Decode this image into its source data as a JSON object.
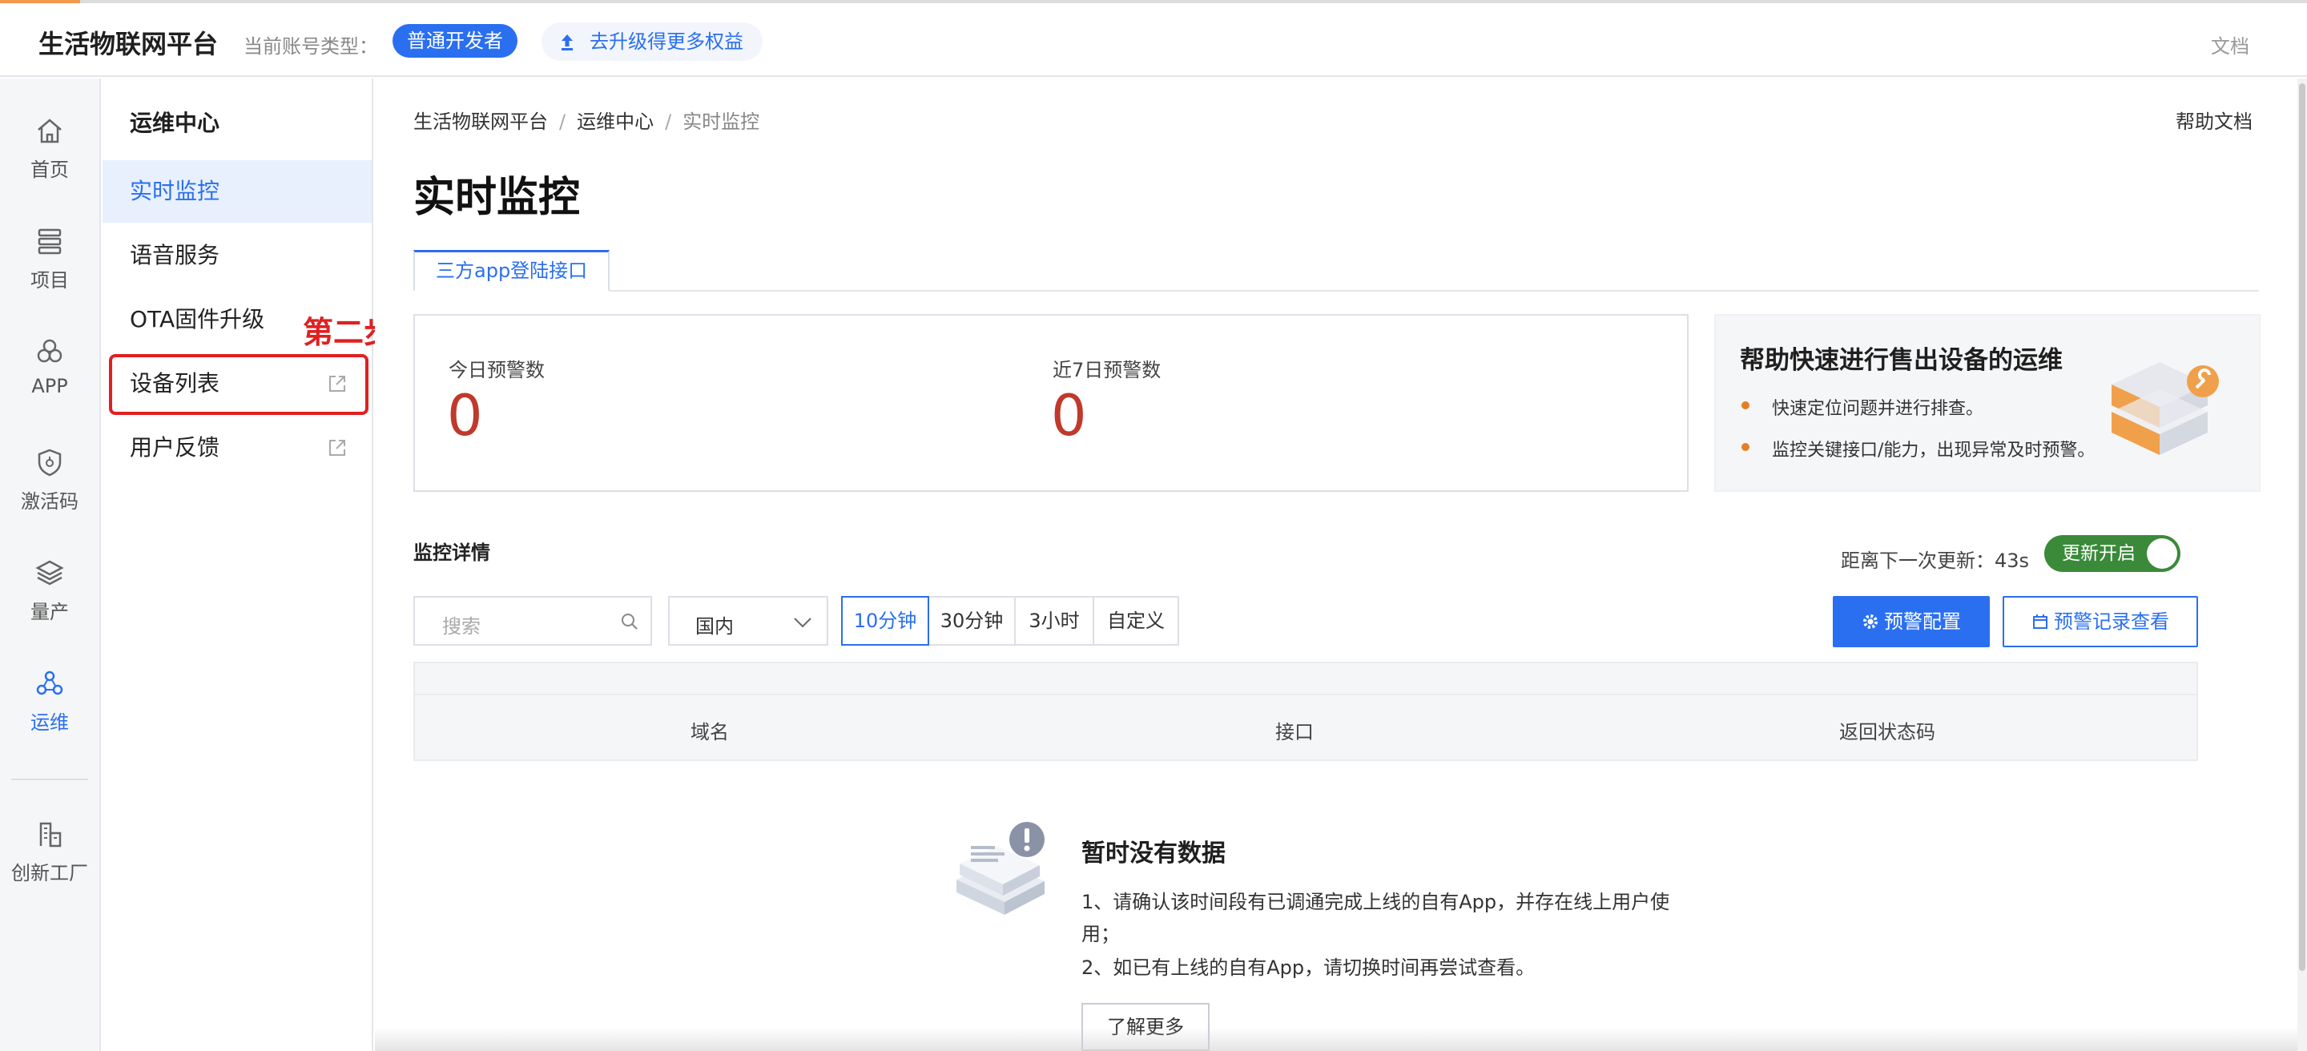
{
  "header": {
    "brand": "生活物联网平台",
    "account_label": "当前账号类型：",
    "account_type": "普通开发者",
    "upgrade": "去升级得更多权益",
    "docs": "文档"
  },
  "nav": {
    "items": [
      {
        "label": "首页",
        "icon": "home-icon"
      },
      {
        "label": "项目",
        "icon": "stack-icon"
      },
      {
        "label": "APP",
        "icon": "circles-icon"
      },
      {
        "label": "激活码",
        "icon": "shield-icon"
      },
      {
        "label": "量产",
        "icon": "layers-icon"
      },
      {
        "label": "运维",
        "icon": "ops-icon",
        "active": true
      },
      {
        "label": "创新工厂",
        "icon": "factory-icon"
      }
    ]
  },
  "menu": {
    "title": "运维中心",
    "items": [
      {
        "label": "实时监控",
        "active": true
      },
      {
        "label": "语音服务"
      },
      {
        "label": "OTA固件升级"
      },
      {
        "label": "设备列表",
        "external": true
      },
      {
        "label": "用户反馈",
        "external": true
      }
    ]
  },
  "annotation": "第二步",
  "breadcrumb": [
    "生活物联网平台",
    "运维中心",
    "实时监控"
  ],
  "help_docs": "帮助文档",
  "page_title": "实时监控",
  "tab": "三方app登陆接口",
  "stats": {
    "today_label": "今日预警数",
    "today_value": "0",
    "week_label": "近7日预警数",
    "week_value": "0"
  },
  "promo": {
    "title": "帮助快速进行售出设备的运维",
    "bullets": [
      "快速定位问题并进行排查。",
      "监控关键接口/能力，出现异常及时预警。"
    ]
  },
  "detail": {
    "title": "监控详情",
    "refresh_label": "距离下一次更新：43s",
    "refresh_toggle": "更新开启",
    "search_placeholder": "搜索",
    "region": "国内",
    "ranges": [
      "10分钟",
      "30分钟",
      "3小时",
      "自定义"
    ],
    "btn_alert": "预警配置",
    "btn_record": "预警记录查看",
    "columns": [
      "域名",
      "接口",
      "返回状态码"
    ]
  },
  "empty": {
    "title": "暂时没有数据",
    "line1": "1、请确认该时间段有已调通完成上线的自有App，并存在线上用户使",
    "line1b": "用；",
    "line2": "2、如已有上线的自有App，请切换时间再尝试查看。",
    "learn_more": "了解更多"
  },
  "colors": {
    "accent": "#2a6ff0",
    "alert": "#c0392b",
    "annotation": "#e02020",
    "toggle": "#3a8a3a"
  }
}
